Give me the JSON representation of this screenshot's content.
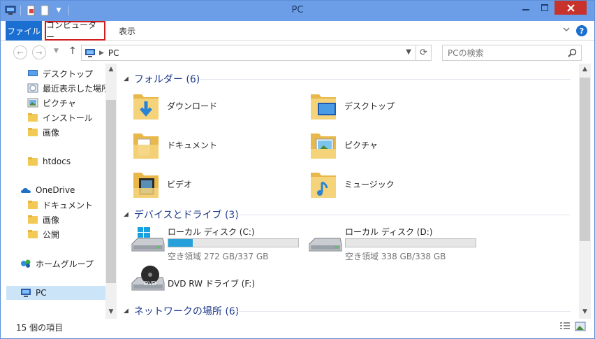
{
  "window": {
    "title": "PC"
  },
  "ribbon": {
    "file_label": "ファイル",
    "computer_label": "コンピューター",
    "view_label": "表示",
    "help_label": "?"
  },
  "address": {
    "location": "PC"
  },
  "search": {
    "placeholder": "PCの検索"
  },
  "nav": {
    "items": [
      {
        "label": "デスクトップ",
        "icon": "desktop-icon"
      },
      {
        "label": "最近表示した場所",
        "icon": "recent-places-icon"
      },
      {
        "label": "ピクチャ",
        "icon": "pictures-icon"
      },
      {
        "label": "インストール",
        "icon": "folder-icon"
      },
      {
        "label": "画像",
        "icon": "folder-icon"
      },
      {
        "label": "htdocs",
        "icon": "folder-icon"
      },
      {
        "label": "OneDrive",
        "icon": "onedrive-icon"
      },
      {
        "label": "ドキュメント",
        "icon": "folder-icon"
      },
      {
        "label": "画像",
        "icon": "folder-icon"
      },
      {
        "label": "公開",
        "icon": "folder-icon"
      },
      {
        "label": "ホームグループ",
        "icon": "homegroup-icon"
      },
      {
        "label": "PC",
        "icon": "pc-icon"
      }
    ]
  },
  "groups": {
    "folders_title": "フォルダー (6)",
    "drives_title": "デバイスとドライブ (3)",
    "network_title": "ネットワークの場所 (6)"
  },
  "folders": [
    {
      "label": "ダウンロード",
      "icon": "downloads-folder-icon"
    },
    {
      "label": "デスクトップ",
      "icon": "desktop-folder-icon"
    },
    {
      "label": "ドキュメント",
      "icon": "documents-folder-icon"
    },
    {
      "label": "ピクチャ",
      "icon": "pictures-folder-icon"
    },
    {
      "label": "ビデオ",
      "icon": "videos-folder-icon"
    },
    {
      "label": "ミュージック",
      "icon": "music-folder-icon"
    }
  ],
  "drives": [
    {
      "name": "ローカル ディスク (C:)",
      "free": "空き領域 272 GB/337 GB",
      "used_fraction": 0.19,
      "icon": "windows-drive-icon"
    },
    {
      "name": "ローカル ディスク (D:)",
      "free": "空き領域 338 GB/338 GB",
      "used_fraction": 0.0,
      "icon": "hard-drive-icon"
    },
    {
      "name": "DVD RW ドライブ (F:)",
      "icon": "dvd-drive-icon",
      "icon_text": "DVD"
    }
  ],
  "status": {
    "count": "15 個の項目"
  },
  "colors": {
    "accent": "#1a6fd1",
    "titlebar": "#6c9ee8",
    "close": "#c7332c",
    "highlight": "#d21d1d",
    "progress": "#26a0da"
  }
}
